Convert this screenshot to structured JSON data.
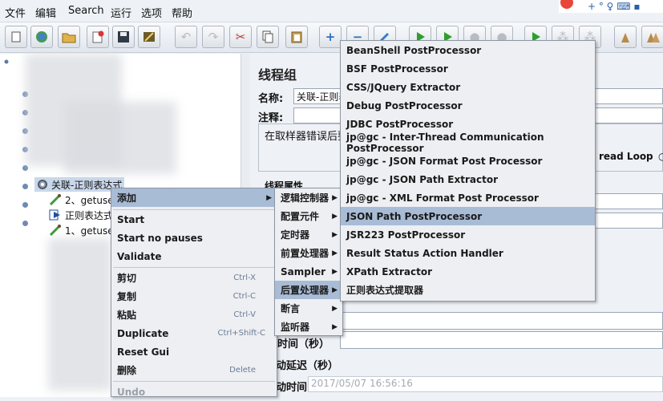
{
  "menubar": {
    "items": [
      "文件",
      "编辑",
      "Search",
      "运行",
      "选项",
      "帮助"
    ]
  },
  "toolbar": {
    "buttons": [
      {
        "icon": "new-icon"
      },
      {
        "icon": "templates-icon"
      },
      {
        "icon": "open-icon"
      },
      {
        "icon": "close-icon"
      },
      {
        "icon": "save-icon"
      },
      {
        "icon": "save-screenshot-icon"
      },
      {
        "icon": "undo-icon"
      },
      {
        "icon": "redo-icon"
      },
      {
        "icon": "cut-icon"
      },
      {
        "icon": "copy-icon"
      },
      {
        "icon": "paste-icon"
      },
      {
        "icon": "expand-icon"
      },
      {
        "icon": "collapse-icon"
      },
      {
        "icon": "toggle-icon"
      },
      {
        "icon": "start-icon"
      },
      {
        "icon": "start-no-pauses-icon"
      },
      {
        "icon": "stop-icon"
      },
      {
        "icon": "shutdown-icon"
      },
      {
        "icon": "remote-start-icon"
      },
      {
        "icon": "remote-stop-icon"
      },
      {
        "icon": "remote-shutdown-icon"
      },
      {
        "icon": "clear-icon"
      },
      {
        "icon": "clear-all-icon"
      }
    ]
  },
  "tree": {
    "selected_node": "关联-正则表达式",
    "children": [
      "2、getuse",
      "正则表达式",
      "1、getuse"
    ]
  },
  "panel": {
    "title": "线程组",
    "name_label": "名称:",
    "name_value": "关联-正则表",
    "comment_label": "注释:",
    "error_text": "在取样器错误后要",
    "thread_props": "线程属性",
    "loop_label": "read Loop",
    "ramp_label": "时间（秒）",
    "delay_label": "动延迟（秒）",
    "start_label": "动时间",
    "start_value": "2017/05/07 16:56:16"
  },
  "context_menu": {
    "items": [
      {
        "label": "添加",
        "submenu": true,
        "highlight": true
      },
      {
        "label": "Start"
      },
      {
        "label": "Start no pauses"
      },
      {
        "label": "Validate"
      },
      {
        "label": "剪切",
        "shortcut": "Ctrl-X"
      },
      {
        "label": "复制",
        "shortcut": "Ctrl-C"
      },
      {
        "label": "粘贴",
        "shortcut": "Ctrl-V"
      },
      {
        "label": "Duplicate",
        "shortcut": "Ctrl+Shift-C"
      },
      {
        "label": "Reset Gui"
      },
      {
        "label": "删除",
        "shortcut": "Delete"
      },
      {
        "label": "Undo",
        "disabled": true
      }
    ]
  },
  "add_submenu": {
    "items": [
      "逻辑控制器",
      "配置元件",
      "定时器",
      "前置处理器",
      "Sampler",
      "后置处理器",
      "断言",
      "监听器"
    ],
    "highlight": "后置处理器"
  },
  "postprocessor_menu": {
    "items": [
      "BeanShell PostProcessor",
      "BSF PostProcessor",
      "CSS/JQuery Extractor",
      "Debug PostProcessor",
      "JDBC PostProcessor",
      "jp@gc - Inter-Thread Communication PostProcessor",
      "jp@gc - JSON Format Post Processor",
      "jp@gc - JSON Path Extractor",
      "jp@gc - XML Format Post Processor",
      "JSON Path PostProcessor",
      "JSR223 PostProcessor",
      "Result Status Action Handler",
      "XPath Extractor",
      "正则表达式提取器"
    ],
    "highlight": "JSON Path PostProcessor"
  },
  "colors": {
    "highlight": "#a9bcd6",
    "menu_bg": "#edeff3",
    "shortcut": "#6a7b93"
  }
}
